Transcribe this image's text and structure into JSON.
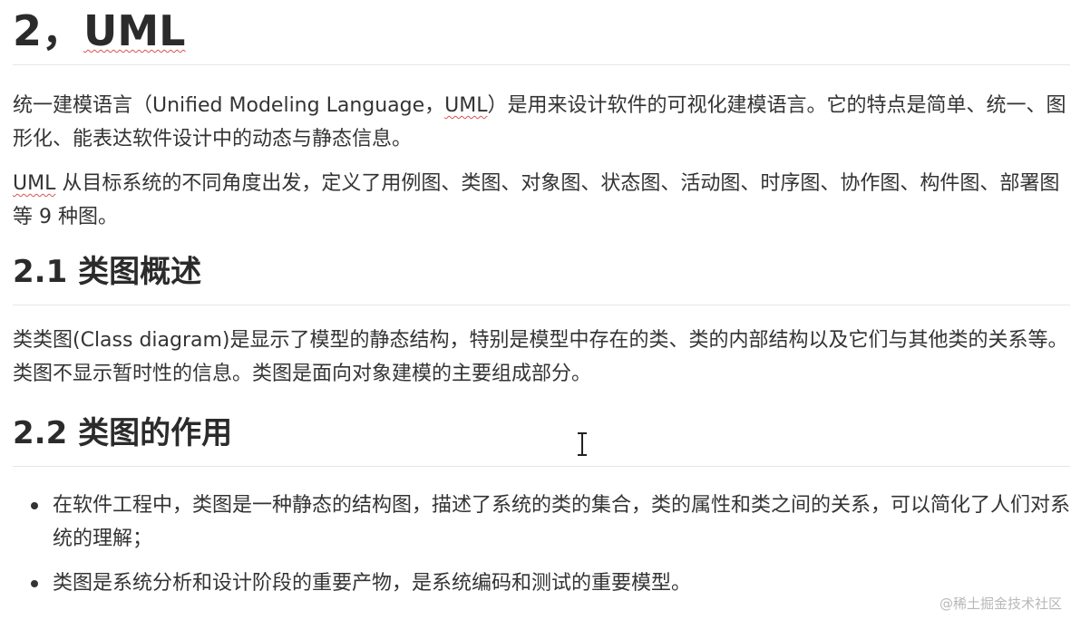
{
  "doc": {
    "title_prefix": "2，",
    "title_uml": "UML",
    "intro_p1_a": "统一建模语言（Unified Modeling Language，",
    "intro_p1_uml": "UML",
    "intro_p1_b": "）是用来设计软件的可视化建模语言。它的特点是简单、统一、图形化、能表达软件设计中的动态与静态信息。",
    "intro_p2_uml": "UML",
    "intro_p2_b": " 从目标系统的不同角度出发，定义了用例图、类图、对象图、状态图、活动图、时序图、协作图、构件图、部署图等 9 种图。",
    "section1_heading": "2.1 类图概述",
    "section1_text": "类类图(Class diagram)是显示了模型的静态结构，特别是模型中存在的类、类的内部结构以及它们与其他类的关系等。类图不显示暂时性的信息。类图是面向对象建模的主要组成部分。",
    "section2_heading": "2.2 类图的作用",
    "bullets": [
      "在软件工程中，类图是一种静态的结构图，描述了系统的类的集合，类的属性和类之间的关系，可以简化了人们对系统的理解；",
      "类图是系统分析和设计阶段的重要产物，是系统编码和测试的重要模型。"
    ]
  },
  "watermark": "@稀土掘金技术社区",
  "cursor_icon": "text-cursor-icon"
}
